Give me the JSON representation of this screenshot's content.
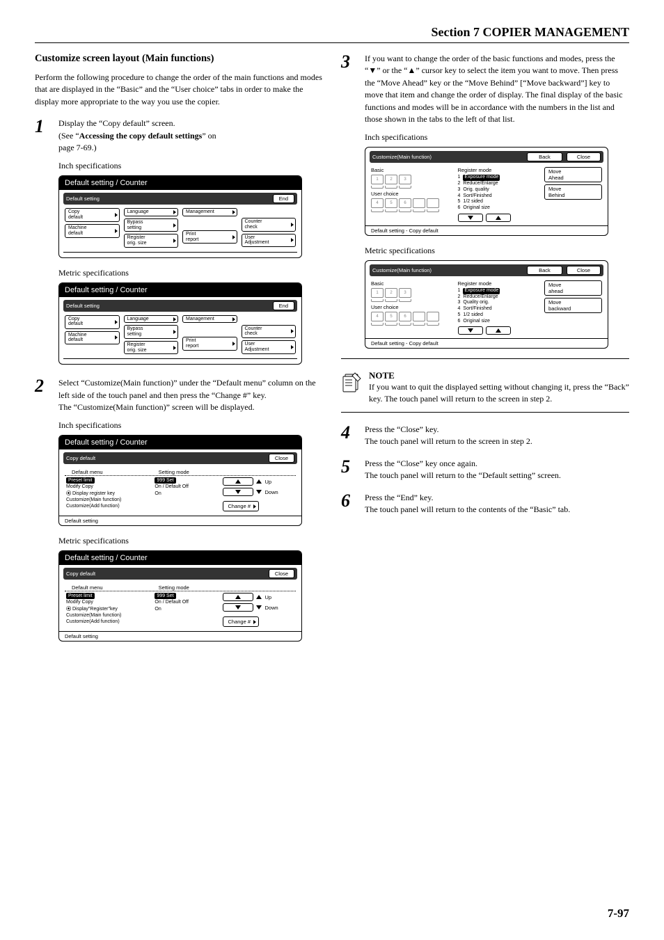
{
  "header": {
    "title": "Section 7  COPIER MANAGEMENT"
  },
  "subhead": "Customize screen layout (Main functions)",
  "intro": "Perform the following procedure to change the order of the main functions and modes that are displayed in the “Basic” and the “User choice” tabs in order to make the display more appropriate to the way you use the copier.",
  "step1": {
    "num": "1",
    "line1": "Display the “Copy default” screen.",
    "line2_pre": "(See “",
    "line2_strong": "Accessing the copy default settings",
    "line2_post": "” on",
    "line3": "page 7-69.)"
  },
  "specs": {
    "inch": "Inch specifications",
    "metric": "Metric specifications"
  },
  "step2": {
    "num": "2",
    "text": "Select “Customize(Main function)” under the “Default menu” column on the left side of the touch panel and then press the “Change #” key.\nThe “Customize(Main function)” screen will be displayed."
  },
  "step3": {
    "num": "3",
    "text": "If you want to change the order of the basic functions and modes, press the “▼” or the “▲” cursor key to select the item you want to move. Then press the “Move Ahead” key or the “Move Behind” [“Move backward”] key to move that item and change the order of display. The final display of the basic functions and modes will be in accordance with the numbers in the list and those shown in the tabs to the left of that list."
  },
  "note": {
    "title": "NOTE",
    "text": "If you want to quit the displayed setting without changing it, press the “Back” key. The touch panel will return to the screen in step 2."
  },
  "step4": {
    "num": "4",
    "l1": "Press the “Close” key.",
    "l2": "The touch panel will return to the screen in step 2."
  },
  "step5": {
    "num": "5",
    "l1": "Press the “Close” key once again.",
    "l2": "The touch panel will return to the “Default setting” screen."
  },
  "step6": {
    "num": "6",
    "l1": "Press the “End” key.",
    "l2": "The touch panel will return to the contents of the “Basic” tab."
  },
  "page_num": "7-97",
  "panelA": {
    "title": "Default setting / Counter",
    "bar": "Default setting",
    "end": "End",
    "btns": {
      "copy_default": "Copy\ndefault",
      "language": "Language",
      "management": "Management",
      "bypass": "Bypass\nsetting",
      "counter": "Counter\ncheck",
      "machine": "Machine\ndefault",
      "register": "Register\norig. size",
      "print": "Print\nreport",
      "user": "User\nAdjustment"
    }
  },
  "panelC": {
    "title": "Default setting / Counter",
    "bar": "Copy default",
    "close": "Close",
    "head": {
      "menu": "Default menu",
      "mode": "Setting mode"
    },
    "items_inch": [
      "Preset limit",
      "Modify Copy",
      "Display register key",
      "Customize(Main function)",
      "Customize(Add function)"
    ],
    "items_metric": [
      "Preset limit",
      "Modify Copy",
      "Display\"Register\"key",
      "Customize(Main function)",
      "Customize(Add function)"
    ],
    "vals": [
      "999 Set",
      "On / Default Off",
      "On"
    ],
    "up": "Up",
    "down": "Down",
    "change": "Change #",
    "footer": "Default setting"
  },
  "panelD": {
    "bar": "Customize(Main function)",
    "back": "Back",
    "close": "Close",
    "basic": "Basic",
    "user": "User choice",
    "reg_title": "Register mode",
    "items_inch": [
      "Exposure mode",
      "Reduce/Enlarge",
      "Orig. quality",
      "Sort/Finished",
      "1/2 sided",
      "Original size"
    ],
    "items_metric": [
      "Exposure mode",
      "Reduce/Enlarge",
      "Quality orig.",
      "Sort/Finished",
      "1/2 sided",
      "Original size"
    ],
    "move_ahead_inch": "Move\nAhead",
    "move_behind_inch": "Move\nBehind",
    "move_ahead_metric": "Move\nahead",
    "move_behind_metric": "Move\nbackward",
    "footer": "Default setting - Copy default",
    "nums": [
      "1",
      "2",
      "3",
      "4",
      "5",
      "6"
    ]
  }
}
